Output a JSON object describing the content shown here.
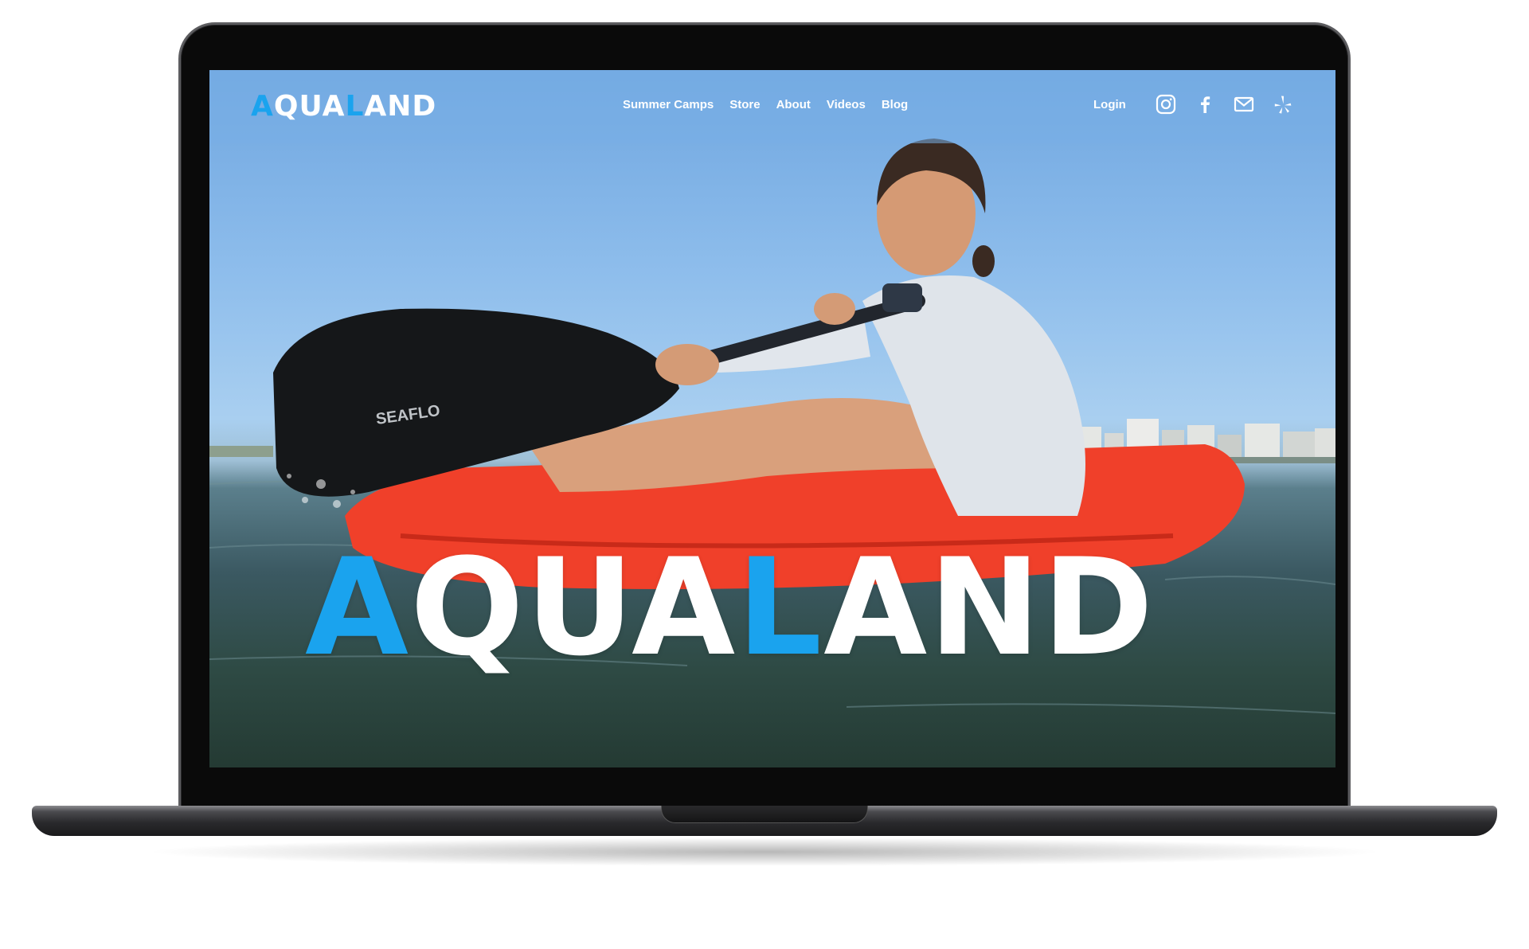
{
  "site": {
    "logo": {
      "part1": "A",
      "part2": "QUA",
      "part3": "L",
      "part4": "AND"
    },
    "hero_logo": {
      "part1": "A",
      "part2": "QUA",
      "part3": "L",
      "part4": "AND"
    }
  },
  "nav": {
    "items": [
      {
        "label": "Summer Camps"
      },
      {
        "label": "Store"
      },
      {
        "label": "About"
      },
      {
        "label": "Videos"
      },
      {
        "label": "Blog"
      }
    ],
    "login_label": "Login"
  },
  "social_icons": [
    "instagram-icon",
    "facebook-icon",
    "mail-icon",
    "yelp-icon"
  ],
  "paddle_brand": "SEAFLO",
  "colors": {
    "accent": "#1aa3ee",
    "nav_text": "#ffffff",
    "kayak": "#f0402a"
  }
}
